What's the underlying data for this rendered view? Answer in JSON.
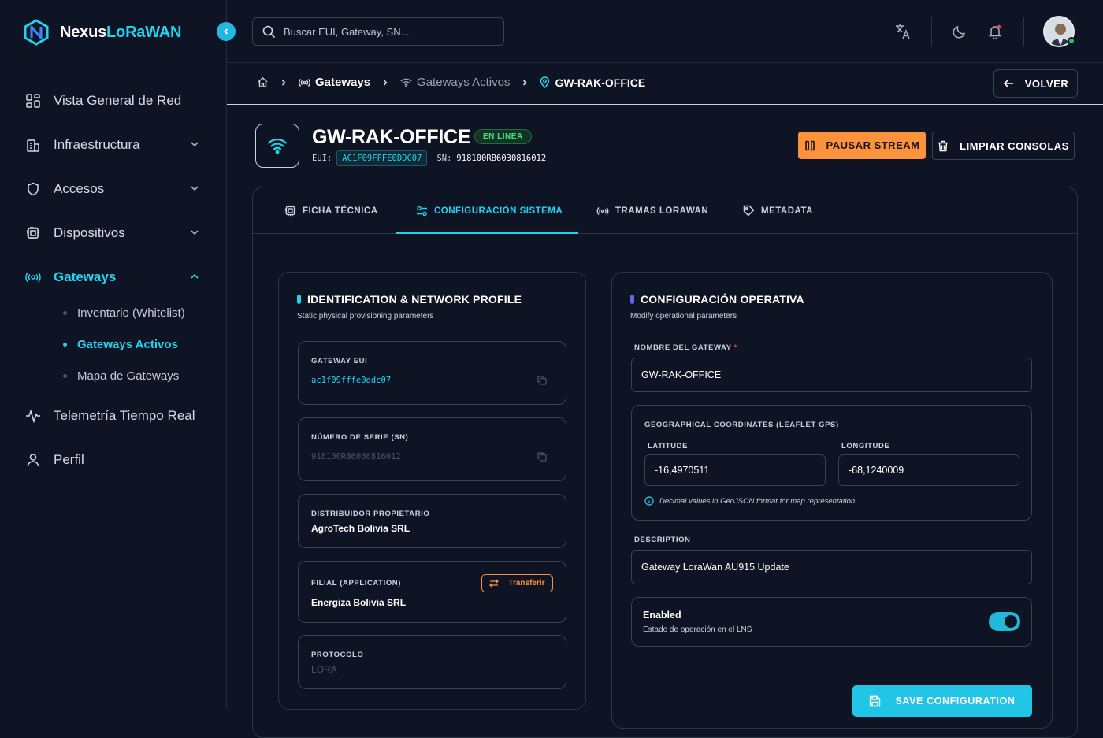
{
  "app": {
    "name_part1": "Nexus",
    "name_part2": "LoRaWAN"
  },
  "sidebar": {
    "items": [
      {
        "label": "Vista General de Red",
        "icon": "grid-icon"
      },
      {
        "label": "Infraestructura",
        "icon": "building-icon"
      },
      {
        "label": "Accesos",
        "icon": "shield-icon"
      },
      {
        "label": "Dispositivos",
        "icon": "chip-icon"
      },
      {
        "label": "Gateways",
        "icon": "broadcast-icon"
      },
      {
        "label": "Telemetría Tiempo Real",
        "icon": "pulse-icon"
      },
      {
        "label": "Perfil",
        "icon": "user-icon"
      }
    ],
    "gateway_sub": [
      "Inventario (Whitelist)",
      "Gateways Activos",
      "Mapa de Gateways"
    ]
  },
  "search": {
    "placeholder": "Buscar EUI, Gateway, SN..."
  },
  "breadcrumb": {
    "gateways": "Gateways",
    "active": "Gateways Activos",
    "current": "GW-RAK-OFFICE"
  },
  "back_label": "VOLVER",
  "gateway": {
    "title": "GW-RAK-OFFICE",
    "status": "EN LÍNEA",
    "eui_label": "EUI:",
    "eui": "AC1F09FFFE0DDC07",
    "sn_label": "SN:",
    "sn": "918100RB6030816012"
  },
  "actions": {
    "pause": "PAUSAR STREAM",
    "clear": "LIMPIAR CONSOLAS"
  },
  "tabs": [
    "FICHA TÉCNICA",
    "CONFIGURACIÓN SISTEMA",
    "TRAMAS LORAWAN",
    "METADATA"
  ],
  "identification": {
    "title": "IDENTIFICATION & NETWORK PROFILE",
    "subtitle": "Static physical provisioning parameters",
    "eui_label": "GATEWAY EUI",
    "eui_value": "ac1f09fffe0ddc07",
    "sn_label": "NÚMERO DE SERIE (SN)",
    "sn_value": "918100RB6030816012",
    "owner_label": "DISTRIBUIDOR PROPIETARIO",
    "owner_value": "AgroTech Bolivia SRL",
    "branch_label": "FILIAL (APPLICATION)",
    "branch_value": "Energiza Bolivia SRL",
    "transfer_label": "Transferir",
    "protocol_label": "PROTOCOLO",
    "protocol_value": "LORA"
  },
  "config": {
    "title": "CONFIGURACIÓN OPERATIVA",
    "subtitle": "Modify operational parameters",
    "name_label": "NOMBRE DEL GATEWAY",
    "name_required": "*",
    "name_value": "GW-RAK-OFFICE",
    "geo_label": "GEOGRAPHICAL COORDINATES (LEAFLET GPS)",
    "lat_label": "LATITUDE",
    "lat_value": "-16,4970511",
    "lon_label": "LONGITUDE",
    "lon_value": "-68,1240009",
    "geo_hint": "Decimal values in GeoJSON format for map representation.",
    "desc_label": "DESCRIPTION",
    "desc_value": "Gateway LoraWan AU915 Update",
    "enabled_label": "Enabled",
    "enabled_sub": "Estado de operación en el LNS",
    "enabled": true,
    "save_label": "SAVE CONFIGURATION"
  },
  "colors": {
    "accent": "#22d3ee",
    "orange": "#fb923c",
    "online": "#4ade80",
    "bg": "#0e1424",
    "purple": "#6366f1"
  }
}
